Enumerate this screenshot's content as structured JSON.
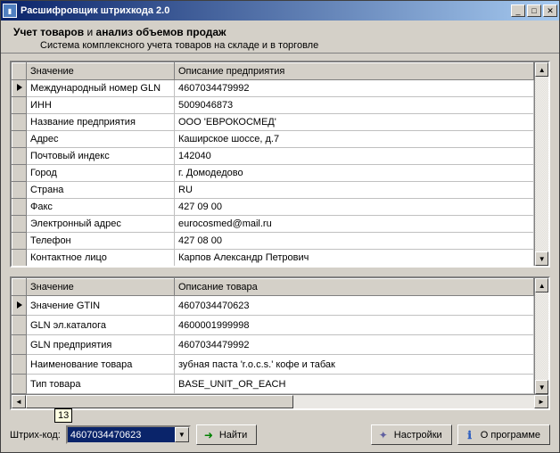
{
  "window": {
    "title": "Расшифровщик штрихкода 2.0"
  },
  "header": {
    "title_strong1": "Учет товаров",
    "title_mid": " и ",
    "title_strong2": "анализ объемов продаж",
    "subtitle": "Система комплексного учета товаров на складе и в торговле"
  },
  "grid1": {
    "col1": "Значение",
    "col2": "Описание предприятия",
    "rows": [
      {
        "label": "Международный номер GLN",
        "value": "4607034479992"
      },
      {
        "label": "ИНН",
        "value": "5009046873"
      },
      {
        "label": "Название предприятия",
        "value": "ООО 'ЕВРОКОСМЕД'"
      },
      {
        "label": "Адрес",
        "value": "Каширское шоссе, д.7"
      },
      {
        "label": "Почтовый индекс",
        "value": "142040"
      },
      {
        "label": "Город",
        "value": "г. Домодедово"
      },
      {
        "label": "Страна",
        "value": "RU"
      },
      {
        "label": "Факс",
        "value": "427 09 00"
      },
      {
        "label": "Электронный адрес",
        "value": "eurocosmed@mail.ru"
      },
      {
        "label": "Телефон",
        "value": "427 08 00"
      },
      {
        "label": "Контактное лицо",
        "value": "Карпов Александр Петрович"
      }
    ]
  },
  "grid2": {
    "col1": "Значение",
    "col2": "Описание товара",
    "rows": [
      {
        "label": "Значение GTIN",
        "value": "4607034470623"
      },
      {
        "label": "GLN эл.каталога",
        "value": "4600001999998"
      },
      {
        "label": "GLN предприятия",
        "value": "4607034479992"
      },
      {
        "label": "Наименование товара",
        "value": "зубная паста 'r.o.c.s.' кофе и табак"
      },
      {
        "label": "Тип товара",
        "value": "BASE_UNIT_OR_EACH"
      }
    ]
  },
  "tooltip_count": "13",
  "bottombar": {
    "label": "Штрих-код:",
    "combo_value": "4607034470623",
    "find": "Найти",
    "settings": "Настройки",
    "about": "О программе"
  }
}
